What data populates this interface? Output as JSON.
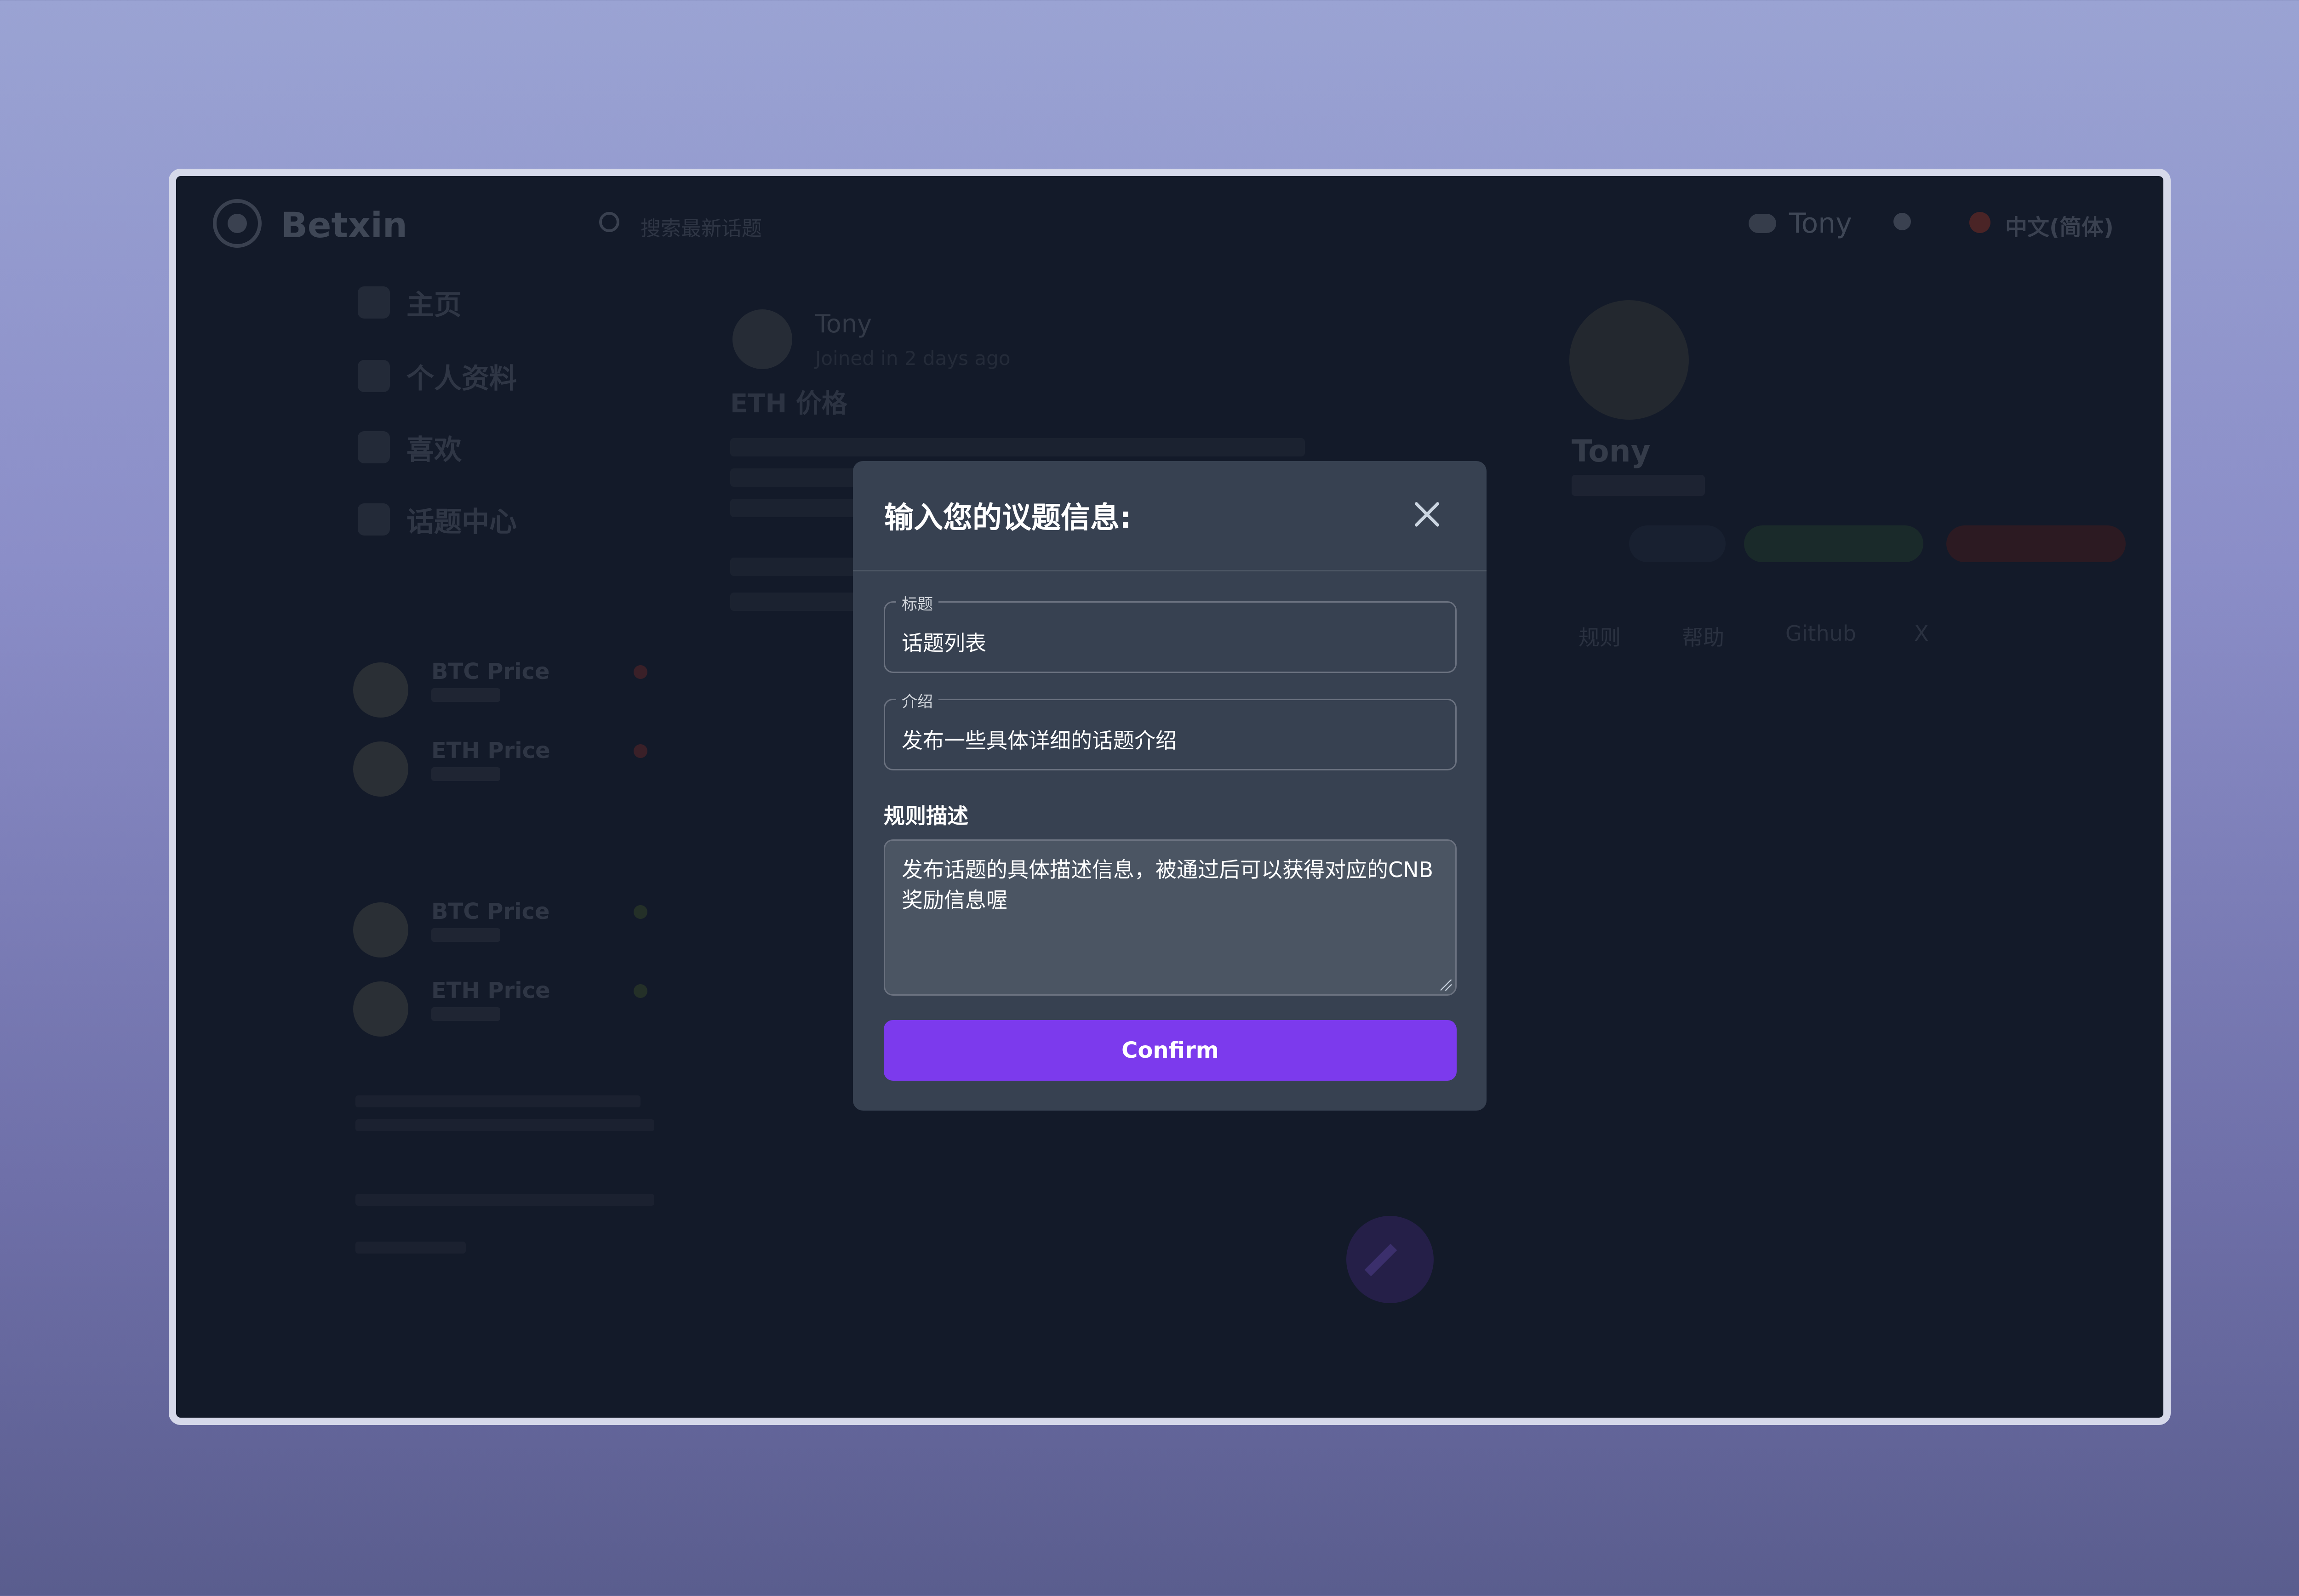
{
  "header": {
    "brand": "Betxin",
    "search_placeholder": "搜索最新话题",
    "user_name": "Tony",
    "language": "中文(简体)"
  },
  "sidebar": {
    "items": [
      {
        "label": "主页",
        "icon": "home-icon"
      },
      {
        "label": "个人资料",
        "icon": "user-icon"
      },
      {
        "label": "喜欢",
        "icon": "heart-icon"
      },
      {
        "label": "话题中心",
        "icon": "topic-icon"
      }
    ],
    "list": [
      {
        "title": "BTC Price"
      },
      {
        "title": "ETH Price"
      },
      {
        "title": "BTC Price"
      },
      {
        "title": "ETH Price"
      }
    ]
  },
  "post": {
    "user": "Tony",
    "meta": "Joined in 2 days ago",
    "title": "ETH 价格"
  },
  "profile": {
    "name": "Tony"
  },
  "links": [
    "规则",
    "帮助",
    "Github",
    "X"
  ],
  "modal": {
    "title": "输入您的议题信息:",
    "title_field": {
      "legend": "标题",
      "value": "话题列表"
    },
    "intro_field": {
      "legend": "介绍",
      "value": "发布一些具体详细的话题介绍"
    },
    "rules_label": "规则描述",
    "rules_value": "发布话题的具体描述信息，被通过后可以获得对应的CNB奖励信息喔",
    "confirm_label": "Confirm"
  },
  "colors": {
    "accent": "#7c3aed",
    "modal_bg": "#374151",
    "page_bg": "#131a29"
  }
}
